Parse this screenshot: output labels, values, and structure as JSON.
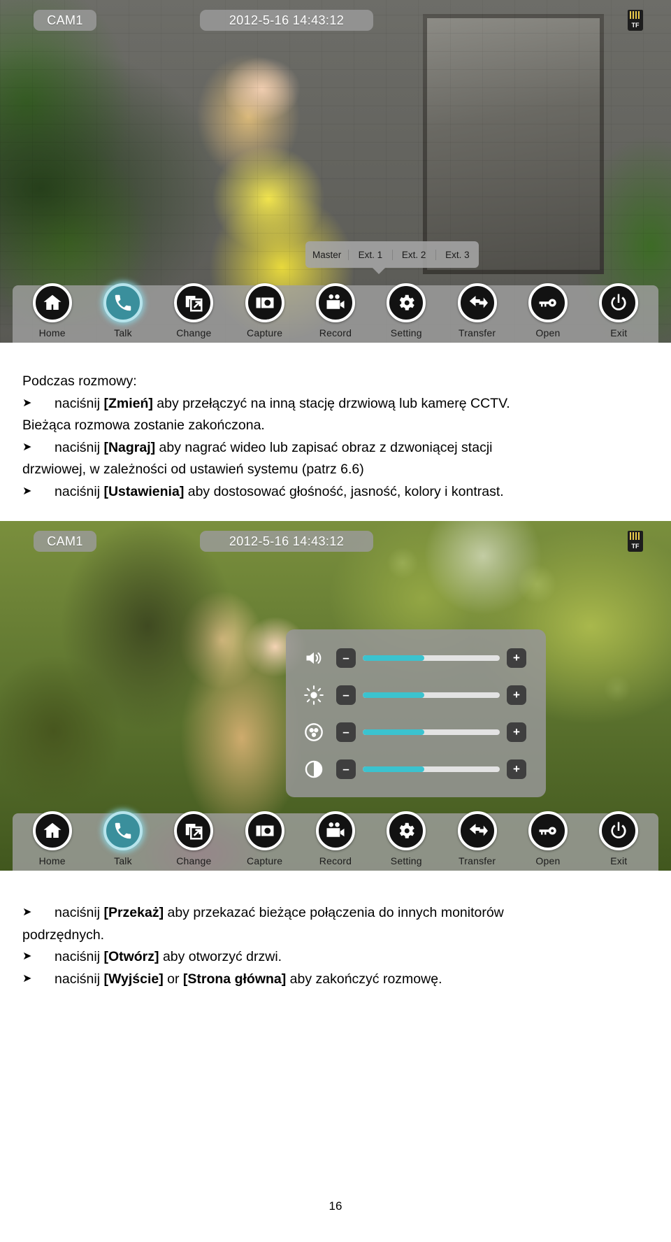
{
  "screens": [
    {
      "id": "screen-talking",
      "cam_label": "CAM1",
      "timestamp": "2012-5-16   14:43:12",
      "storage_icon_label": "TF",
      "ext_popup": {
        "visible": true,
        "items": [
          "Master",
          "Ext. 1",
          "Ext. 2",
          "Ext. 3"
        ]
      },
      "settings_panel": {
        "visible": false
      },
      "toolbar": {
        "active_index": 1,
        "buttons": [
          {
            "label": "Home",
            "icon": "home-icon"
          },
          {
            "label": "Talk",
            "icon": "phone-icon"
          },
          {
            "label": "Change",
            "icon": "switch-window-icon"
          },
          {
            "label": "Capture",
            "icon": "camera-icon"
          },
          {
            "label": "Record",
            "icon": "video-camera-icon"
          },
          {
            "label": "Setting",
            "icon": "gear-icon"
          },
          {
            "label": "Transfer",
            "icon": "transfer-arrow-icon"
          },
          {
            "label": "Open",
            "icon": "key-icon"
          },
          {
            "label": "Exit",
            "icon": "power-icon"
          }
        ]
      }
    },
    {
      "id": "screen-settings",
      "cam_label": "CAM1",
      "timestamp": "2012-5-16   14:43:12",
      "storage_icon_label": "TF",
      "ext_popup": {
        "visible": false,
        "items": []
      },
      "settings_panel": {
        "visible": true,
        "decrement_label": "–",
        "increment_label": "+",
        "sliders": [
          {
            "name": "volume",
            "icon": "speaker-icon",
            "value": 45
          },
          {
            "name": "brightness",
            "icon": "sun-icon",
            "value": 45
          },
          {
            "name": "color",
            "icon": "color-wheel-icon",
            "value": 45
          },
          {
            "name": "contrast",
            "icon": "contrast-icon",
            "value": 45
          }
        ]
      },
      "toolbar": {
        "active_index": 1,
        "buttons": [
          {
            "label": "Home",
            "icon": "home-icon"
          },
          {
            "label": "Talk",
            "icon": "phone-icon"
          },
          {
            "label": "Change",
            "icon": "switch-window-icon"
          },
          {
            "label": "Capture",
            "icon": "camera-icon"
          },
          {
            "label": "Record",
            "icon": "video-camera-icon"
          },
          {
            "label": "Setting",
            "icon": "gear-icon"
          },
          {
            "label": "Transfer",
            "icon": "transfer-arrow-icon"
          },
          {
            "label": "Open",
            "icon": "key-icon"
          },
          {
            "label": "Exit",
            "icon": "power-icon"
          }
        ]
      }
    }
  ],
  "text_top": {
    "heading": "Podczas rozmowy:",
    "bullets": [
      {
        "arrow": "➤",
        "prefix": "naciśnij ",
        "bold": "[Zmień]",
        "suffix": " aby przełączyć na inną stację drzwiową lub kamerę CCTV.",
        "continuation": "Bieżąca rozmowa zostanie zakończona."
      },
      {
        "arrow": "➤",
        "prefix": "naciśnij ",
        "bold": "[Nagraj]",
        "suffix": " aby nagrać wideo lub zapisać obraz z dzwoniącej stacji",
        "continuation": "drzwiowej, w zależności od ustawień systemu (patrz 6.6)"
      },
      {
        "arrow": "➤",
        "prefix": "naciśnij ",
        "bold": "[Ustawienia]",
        "suffix": " aby dostosować głośność, jasność, kolory i kontrast.",
        "continuation": ""
      }
    ]
  },
  "text_bottom": {
    "bullets": [
      {
        "arrow": "➤",
        "prefix": "naciśnij ",
        "bold": "[Przekaż]",
        "suffix": " aby przekazać bieżące połączenia do innych monitorów",
        "continuation": "podrzędnych."
      },
      {
        "arrow": "➤",
        "prefix": "naciśnij ",
        "bold": "[Otwórz]",
        "suffix": " aby otworzyć drzwi.",
        "continuation": ""
      },
      {
        "arrow": "➤",
        "prefix": "naciśnij ",
        "bold": "[Wyjście]",
        "mid": " or ",
        "bold2": "[Strona główna]",
        "suffix": " aby zakończyć rozmowę.",
        "continuation": ""
      }
    ]
  },
  "page_number": "16",
  "colors": {
    "slider_fill": "#3bc3cf",
    "slider_track": "#e3e3e3",
    "active_button": "#3a8f9c",
    "overlay_grey": "rgba(160,160,160,.80)"
  }
}
